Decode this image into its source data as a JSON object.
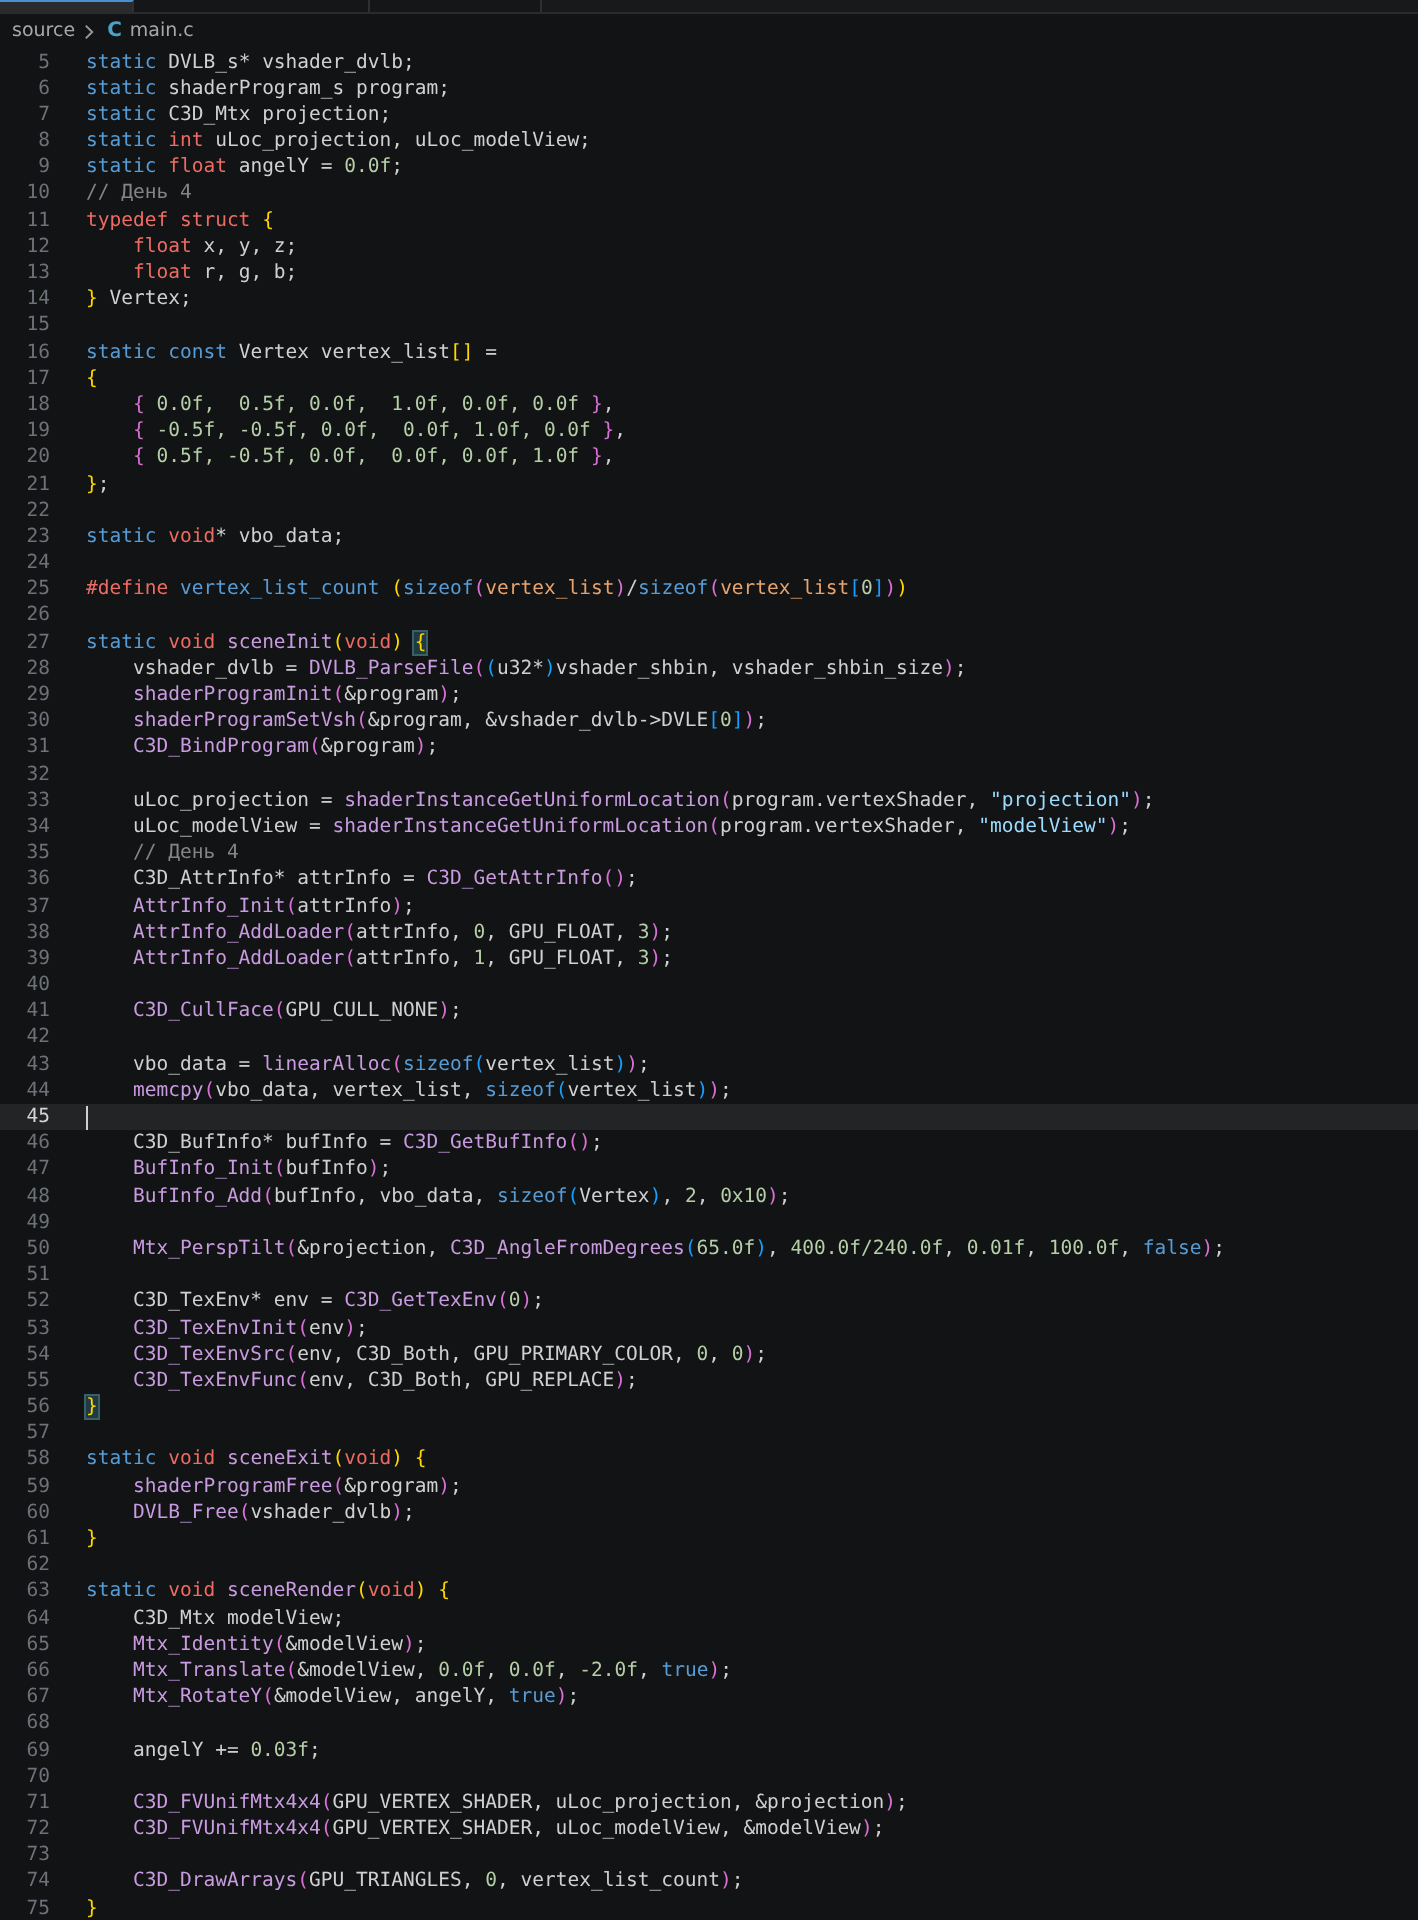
{
  "tabs": [
    {
      "selected": true
    },
    {
      "selected": false
    },
    {
      "selected": false
    }
  ],
  "breadcrumb": {
    "folder": "source",
    "file_icon": "C",
    "file": "main.c"
  },
  "lines": [
    {
      "number": "5",
      "current": false,
      "tokens": [
        {
          "kind": "kw",
          "text": "static"
        },
        {
          "kind": "txt",
          "text": " DVLB_s* vshader_dvlb;"
        }
      ]
    },
    {
      "number": "6",
      "current": false,
      "tokens": [
        {
          "kind": "kw",
          "text": "static"
        },
        {
          "kind": "txt",
          "text": " shaderProgram_s program;"
        }
      ]
    },
    {
      "number": "7",
      "current": false,
      "tokens": [
        {
          "kind": "kw",
          "text": "static"
        },
        {
          "kind": "txt",
          "text": " C3D_Mtx projection;"
        }
      ]
    },
    {
      "number": "8",
      "current": false,
      "tokens": [
        {
          "kind": "kw",
          "text": "static "
        },
        {
          "kind": "type",
          "text": "int"
        },
        {
          "kind": "txt",
          "text": " uLoc_projection, uLoc_modelView;"
        }
      ]
    },
    {
      "number": "9",
      "current": false,
      "tokens": [
        {
          "kind": "kw",
          "text": "static "
        },
        {
          "kind": "type",
          "text": "float"
        },
        {
          "kind": "txt",
          "text": " angelY = "
        },
        {
          "kind": "num",
          "text": "0.0f"
        },
        {
          "kind": "txt",
          "text": ";"
        }
      ]
    },
    {
      "number": "10",
      "current": false,
      "tokens": [
        {
          "kind": "cmt",
          "text": "// День 4"
        }
      ]
    },
    {
      "number": "11",
      "current": false,
      "tokens": [
        {
          "kind": "type",
          "text": "typedef struct "
        },
        {
          "kind": "b1",
          "text": "{"
        }
      ]
    },
    {
      "number": "12",
      "current": false,
      "tokens": [
        {
          "kind": "type",
          "text": "    float"
        },
        {
          "kind": "txt",
          "text": " x, y, z;"
        }
      ]
    },
    {
      "number": "13",
      "current": false,
      "tokens": [
        {
          "kind": "type",
          "text": "    float"
        },
        {
          "kind": "txt",
          "text": " r, g, b;"
        }
      ]
    },
    {
      "number": "14",
      "current": false,
      "tokens": [
        {
          "kind": "b1",
          "text": "}"
        },
        {
          "kind": "txt",
          "text": " Vertex;"
        }
      ]
    },
    {
      "number": "15",
      "current": false
    },
    {
      "number": "16",
      "current": false,
      "tokens": [
        {
          "kind": "kw",
          "text": "static const"
        },
        {
          "kind": "txt",
          "text": " Vertex vertex_list"
        },
        {
          "kind": "b1",
          "text": "[]"
        },
        {
          "kind": "txt",
          "text": " ="
        }
      ]
    },
    {
      "number": "17",
      "current": false,
      "tokens": [
        {
          "kind": "b1",
          "text": "{"
        }
      ]
    },
    {
      "number": "18",
      "current": false,
      "tokens": [
        {
          "kind": "b2",
          "text": "    { "
        },
        {
          "kind": "num",
          "text": "0.0f,  0.5f, 0.0f,  1.0f, 0.0f, 0.0f "
        },
        {
          "kind": "b2",
          "text": "}"
        },
        {
          "kind": "txt",
          "text": ","
        }
      ]
    },
    {
      "number": "19",
      "current": false,
      "tokens": [
        {
          "kind": "b2",
          "text": "    { "
        },
        {
          "kind": "num",
          "text": "-0.5f, -0.5f, 0.0f,  0.0f, 1.0f, 0.0f "
        },
        {
          "kind": "b2",
          "text": "}"
        },
        {
          "kind": "txt",
          "text": ","
        }
      ]
    },
    {
      "number": "20",
      "current": false,
      "tokens": [
        {
          "kind": "b2",
          "text": "    { "
        },
        {
          "kind": "num",
          "text": "0.5f, -0.5f, 0.0f,  0.0f, 0.0f, 1.0f "
        },
        {
          "kind": "b2",
          "text": "}"
        },
        {
          "kind": "txt",
          "text": ","
        }
      ]
    },
    {
      "number": "21",
      "current": false,
      "tokens": [
        {
          "kind": "b1",
          "text": "}"
        },
        {
          "kind": "txt",
          "text": ";"
        }
      ]
    },
    {
      "number": "22",
      "current": false
    },
    {
      "number": "23",
      "current": false,
      "tokens": [
        {
          "kind": "kw",
          "text": "static "
        },
        {
          "kind": "type",
          "text": "void"
        },
        {
          "kind": "txt",
          "text": "* vbo_data;"
        }
      ]
    },
    {
      "number": "24",
      "current": false
    },
    {
      "number": "25",
      "current": false,
      "tokens": [
        {
          "kind": "type",
          "text": "#define "
        },
        {
          "kind": "kw",
          "text": "vertex_list_count "
        },
        {
          "kind": "b1",
          "text": "("
        },
        {
          "kind": "kw",
          "text": "sizeof"
        },
        {
          "kind": "b2",
          "text": "("
        },
        {
          "kind": "arg",
          "text": "vertex_list"
        },
        {
          "kind": "b2",
          "text": ")"
        },
        {
          "kind": "txt",
          "text": "/"
        },
        {
          "kind": "kw",
          "text": "sizeof"
        },
        {
          "kind": "b2",
          "text": "("
        },
        {
          "kind": "arg",
          "text": "vertex_list"
        },
        {
          "kind": "b3",
          "text": "["
        },
        {
          "kind": "num",
          "text": "0"
        },
        {
          "kind": "b3",
          "text": "]"
        },
        {
          "kind": "b2",
          "text": ")"
        },
        {
          "kind": "b1",
          "text": ")"
        }
      ]
    },
    {
      "number": "26",
      "current": false
    },
    {
      "number": "27",
      "current": false,
      "tokens": [
        {
          "kind": "kw",
          "text": "static "
        },
        {
          "kind": "type",
          "text": "void "
        },
        {
          "kind": "fn",
          "text": "sceneInit"
        },
        {
          "kind": "b1",
          "text": "("
        },
        {
          "kind": "type",
          "text": "void"
        },
        {
          "kind": "b1",
          "text": ") "
        },
        {
          "kind": "match",
          "text": "{"
        }
      ]
    },
    {
      "number": "28",
      "current": false,
      "tokens": [
        {
          "kind": "txt",
          "text": "    vshader_dvlb = "
        },
        {
          "kind": "fn",
          "text": "DVLB_ParseFile"
        },
        {
          "kind": "b2",
          "text": "("
        },
        {
          "kind": "b3",
          "text": "("
        },
        {
          "kind": "txt",
          "text": "u32*"
        },
        {
          "kind": "b3",
          "text": ")"
        },
        {
          "kind": "txt",
          "text": "vshader_shbin, vshader_shbin_size"
        },
        {
          "kind": "b2",
          "text": ")"
        },
        {
          "kind": "txt",
          "text": ";"
        }
      ]
    },
    {
      "number": "29",
      "current": false,
      "tokens": [
        {
          "kind": "fn",
          "text": "    shaderProgramInit"
        },
        {
          "kind": "b2",
          "text": "("
        },
        {
          "kind": "txt",
          "text": "&program"
        },
        {
          "kind": "b2",
          "text": ")"
        },
        {
          "kind": "txt",
          "text": ";"
        }
      ]
    },
    {
      "number": "30",
      "current": false,
      "tokens": [
        {
          "kind": "fn",
          "text": "    shaderProgramSetVsh"
        },
        {
          "kind": "b2",
          "text": "("
        },
        {
          "kind": "txt",
          "text": "&program, &vshader_dvlb->DVLE"
        },
        {
          "kind": "b3",
          "text": "["
        },
        {
          "kind": "num",
          "text": "0"
        },
        {
          "kind": "b3",
          "text": "]"
        },
        {
          "kind": "b2",
          "text": ")"
        },
        {
          "kind": "txt",
          "text": ";"
        }
      ]
    },
    {
      "number": "31",
      "current": false,
      "tokens": [
        {
          "kind": "fn",
          "text": "    C3D_BindProgram"
        },
        {
          "kind": "b2",
          "text": "("
        },
        {
          "kind": "txt",
          "text": "&program"
        },
        {
          "kind": "b2",
          "text": ")"
        },
        {
          "kind": "txt",
          "text": ";"
        }
      ]
    },
    {
      "number": "32",
      "current": false
    },
    {
      "number": "33",
      "current": false,
      "tokens": [
        {
          "kind": "txt",
          "text": "    uLoc_projection = "
        },
        {
          "kind": "fn",
          "text": "shaderInstanceGetUniformLocation"
        },
        {
          "kind": "b2",
          "text": "("
        },
        {
          "kind": "txt",
          "text": "program.vertexShader, "
        },
        {
          "kind": "str",
          "text": "\"projection\""
        },
        {
          "kind": "b2",
          "text": ")"
        },
        {
          "kind": "txt",
          "text": ";"
        }
      ]
    },
    {
      "number": "34",
      "current": false,
      "tokens": [
        {
          "kind": "txt",
          "text": "    uLoc_modelView = "
        },
        {
          "kind": "fn",
          "text": "shaderInstanceGetUniformLocation"
        },
        {
          "kind": "b2",
          "text": "("
        },
        {
          "kind": "txt",
          "text": "program.vertexShader, "
        },
        {
          "kind": "str",
          "text": "\"modelView\""
        },
        {
          "kind": "b2",
          "text": ")"
        },
        {
          "kind": "txt",
          "text": ";"
        }
      ]
    },
    {
      "number": "35",
      "current": false,
      "tokens": [
        {
          "kind": "cmt",
          "text": "    // День 4"
        }
      ]
    },
    {
      "number": "36",
      "current": false,
      "tokens": [
        {
          "kind": "txt",
          "text": "    C3D_AttrInfo* attrInfo = "
        },
        {
          "kind": "fn",
          "text": "C3D_GetAttrInfo"
        },
        {
          "kind": "b2",
          "text": "()"
        },
        {
          "kind": "txt",
          "text": ";"
        }
      ]
    },
    {
      "number": "37",
      "current": false,
      "tokens": [
        {
          "kind": "fn",
          "text": "    AttrInfo_Init"
        },
        {
          "kind": "b2",
          "text": "("
        },
        {
          "kind": "txt",
          "text": "attrInfo"
        },
        {
          "kind": "b2",
          "text": ")"
        },
        {
          "kind": "txt",
          "text": ";"
        }
      ]
    },
    {
      "number": "38",
      "current": false,
      "tokens": [
        {
          "kind": "fn",
          "text": "    AttrInfo_AddLoader"
        },
        {
          "kind": "b2",
          "text": "("
        },
        {
          "kind": "txt",
          "text": "attrInfo, "
        },
        {
          "kind": "num",
          "text": "0"
        },
        {
          "kind": "txt",
          "text": ", GPU_FLOAT, "
        },
        {
          "kind": "num",
          "text": "3"
        },
        {
          "kind": "b2",
          "text": ")"
        },
        {
          "kind": "txt",
          "text": ";"
        }
      ]
    },
    {
      "number": "39",
      "current": false,
      "tokens": [
        {
          "kind": "fn",
          "text": "    AttrInfo_AddLoader"
        },
        {
          "kind": "b2",
          "text": "("
        },
        {
          "kind": "txt",
          "text": "attrInfo, "
        },
        {
          "kind": "num",
          "text": "1"
        },
        {
          "kind": "txt",
          "text": ", GPU_FLOAT, "
        },
        {
          "kind": "num",
          "text": "3"
        },
        {
          "kind": "b2",
          "text": ")"
        },
        {
          "kind": "txt",
          "text": ";"
        }
      ]
    },
    {
      "number": "40",
      "current": false
    },
    {
      "number": "41",
      "current": false,
      "tokens": [
        {
          "kind": "fn",
          "text": "    C3D_CullFace"
        },
        {
          "kind": "b2",
          "text": "("
        },
        {
          "kind": "txt",
          "text": "GPU_CULL_NONE"
        },
        {
          "kind": "b2",
          "text": ")"
        },
        {
          "kind": "txt",
          "text": ";"
        }
      ]
    },
    {
      "number": "42",
      "current": false
    },
    {
      "number": "43",
      "current": false,
      "tokens": [
        {
          "kind": "txt",
          "text": "    vbo_data = "
        },
        {
          "kind": "fn",
          "text": "linearAlloc"
        },
        {
          "kind": "b2",
          "text": "("
        },
        {
          "kind": "kw",
          "text": "sizeof"
        },
        {
          "kind": "b3",
          "text": "("
        },
        {
          "kind": "txt",
          "text": "vertex_list"
        },
        {
          "kind": "b3",
          "text": ")"
        },
        {
          "kind": "b2",
          "text": ")"
        },
        {
          "kind": "txt",
          "text": ";"
        }
      ]
    },
    {
      "number": "44",
      "current": false,
      "tokens": [
        {
          "kind": "fn",
          "text": "    memcpy"
        },
        {
          "kind": "b2",
          "text": "("
        },
        {
          "kind": "txt",
          "text": "vbo_data, vertex_list, "
        },
        {
          "kind": "kw",
          "text": "sizeof"
        },
        {
          "kind": "b3",
          "text": "("
        },
        {
          "kind": "txt",
          "text": "vertex_list"
        },
        {
          "kind": "b3",
          "text": ")"
        },
        {
          "kind": "b2",
          "text": ")"
        },
        {
          "kind": "txt",
          "text": ";"
        }
      ]
    },
    {
      "number": "45",
      "current": true
    },
    {
      "number": "46",
      "current": false,
      "tokens": [
        {
          "kind": "txt",
          "text": "    C3D_BufInfo* bufInfo = "
        },
        {
          "kind": "fn",
          "text": "C3D_GetBufInfo"
        },
        {
          "kind": "b2",
          "text": "()"
        },
        {
          "kind": "txt",
          "text": ";"
        }
      ]
    },
    {
      "number": "47",
      "current": false,
      "tokens": [
        {
          "kind": "fn",
          "text": "    BufInfo_Init"
        },
        {
          "kind": "b2",
          "text": "("
        },
        {
          "kind": "txt",
          "text": "bufInfo"
        },
        {
          "kind": "b2",
          "text": ")"
        },
        {
          "kind": "txt",
          "text": ";"
        }
      ]
    },
    {
      "number": "48",
      "current": false,
      "tokens": [
        {
          "kind": "fn",
          "text": "    BufInfo_Add"
        },
        {
          "kind": "b2",
          "text": "("
        },
        {
          "kind": "txt",
          "text": "bufInfo, vbo_data, "
        },
        {
          "kind": "kw",
          "text": "sizeof"
        },
        {
          "kind": "b3",
          "text": "("
        },
        {
          "kind": "txt",
          "text": "Vertex"
        },
        {
          "kind": "b3",
          "text": ")"
        },
        {
          "kind": "txt",
          "text": ", "
        },
        {
          "kind": "num",
          "text": "2"
        },
        {
          "kind": "txt",
          "text": ", "
        },
        {
          "kind": "num",
          "text": "0x10"
        },
        {
          "kind": "b2",
          "text": ")"
        },
        {
          "kind": "txt",
          "text": ";"
        }
      ]
    },
    {
      "number": "49",
      "current": false
    },
    {
      "number": "50",
      "current": false,
      "tokens": [
        {
          "kind": "fn",
          "text": "    Mtx_PerspTilt"
        },
        {
          "kind": "b2",
          "text": "("
        },
        {
          "kind": "txt",
          "text": "&projection, "
        },
        {
          "kind": "fn",
          "text": "C3D_AngleFromDegrees"
        },
        {
          "kind": "b3",
          "text": "("
        },
        {
          "kind": "num",
          "text": "65.0f"
        },
        {
          "kind": "b3",
          "text": ")"
        },
        {
          "kind": "txt",
          "text": ", "
        },
        {
          "kind": "num",
          "text": "400.0f/240.0f"
        },
        {
          "kind": "txt",
          "text": ", "
        },
        {
          "kind": "num",
          "text": "0.01f"
        },
        {
          "kind": "txt",
          "text": ", "
        },
        {
          "kind": "num",
          "text": "100.0f"
        },
        {
          "kind": "txt",
          "text": ", "
        },
        {
          "kind": "kw",
          "text": "false"
        },
        {
          "kind": "b2",
          "text": ")"
        },
        {
          "kind": "txt",
          "text": ";"
        }
      ]
    },
    {
      "number": "51",
      "current": false
    },
    {
      "number": "52",
      "current": false,
      "tokens": [
        {
          "kind": "txt",
          "text": "    C3D_TexEnv* env = "
        },
        {
          "kind": "fn",
          "text": "C3D_GetTexEnv"
        },
        {
          "kind": "b2",
          "text": "("
        },
        {
          "kind": "num",
          "text": "0"
        },
        {
          "kind": "b2",
          "text": ")"
        },
        {
          "kind": "txt",
          "text": ";"
        }
      ]
    },
    {
      "number": "53",
      "current": false,
      "tokens": [
        {
          "kind": "fn",
          "text": "    C3D_TexEnvInit"
        },
        {
          "kind": "b2",
          "text": "("
        },
        {
          "kind": "txt",
          "text": "env"
        },
        {
          "kind": "b2",
          "text": ")"
        },
        {
          "kind": "txt",
          "text": ";"
        }
      ]
    },
    {
      "number": "54",
      "current": false,
      "tokens": [
        {
          "kind": "fn",
          "text": "    C3D_TexEnvSrc"
        },
        {
          "kind": "b2",
          "text": "("
        },
        {
          "kind": "txt",
          "text": "env, C3D_Both, GPU_PRIMARY_COLOR, "
        },
        {
          "kind": "num",
          "text": "0"
        },
        {
          "kind": "txt",
          "text": ", "
        },
        {
          "kind": "num",
          "text": "0"
        },
        {
          "kind": "b2",
          "text": ")"
        },
        {
          "kind": "txt",
          "text": ";"
        }
      ]
    },
    {
      "number": "55",
      "current": false,
      "tokens": [
        {
          "kind": "fn",
          "text": "    C3D_TexEnvFunc"
        },
        {
          "kind": "b2",
          "text": "("
        },
        {
          "kind": "txt",
          "text": "env, C3D_Both, GPU_REPLACE"
        },
        {
          "kind": "b2",
          "text": ")"
        },
        {
          "kind": "txt",
          "text": ";"
        }
      ]
    },
    {
      "number": "56",
      "current": false,
      "tokens": [
        {
          "kind": "match",
          "text": "}"
        }
      ]
    },
    {
      "number": "57",
      "current": false
    },
    {
      "number": "58",
      "current": false,
      "tokens": [
        {
          "kind": "kw",
          "text": "static "
        },
        {
          "kind": "type",
          "text": "void "
        },
        {
          "kind": "fn",
          "text": "sceneExit"
        },
        {
          "kind": "b1",
          "text": "("
        },
        {
          "kind": "type",
          "text": "void"
        },
        {
          "kind": "b1",
          "text": ") {"
        }
      ]
    },
    {
      "number": "59",
      "current": false,
      "tokens": [
        {
          "kind": "fn",
          "text": "    shaderProgramFree"
        },
        {
          "kind": "b2",
          "text": "("
        },
        {
          "kind": "txt",
          "text": "&program"
        },
        {
          "kind": "b2",
          "text": ")"
        },
        {
          "kind": "txt",
          "text": ";"
        }
      ]
    },
    {
      "number": "60",
      "current": false,
      "tokens": [
        {
          "kind": "fn",
          "text": "    DVLB_Free"
        },
        {
          "kind": "b2",
          "text": "("
        },
        {
          "kind": "txt",
          "text": "vshader_dvlb"
        },
        {
          "kind": "b2",
          "text": ")"
        },
        {
          "kind": "txt",
          "text": ";"
        }
      ]
    },
    {
      "number": "61",
      "current": false,
      "tokens": [
        {
          "kind": "b1",
          "text": "}"
        }
      ]
    },
    {
      "number": "62",
      "current": false
    },
    {
      "number": "63",
      "current": false,
      "tokens": [
        {
          "kind": "kw",
          "text": "static "
        },
        {
          "kind": "type",
          "text": "void "
        },
        {
          "kind": "fn",
          "text": "sceneRender"
        },
        {
          "kind": "b1",
          "text": "("
        },
        {
          "kind": "type",
          "text": "void"
        },
        {
          "kind": "b1",
          "text": ") {"
        }
      ]
    },
    {
      "number": "64",
      "current": false,
      "tokens": [
        {
          "kind": "txt",
          "text": "    C3D_Mtx modelView;"
        }
      ]
    },
    {
      "number": "65",
      "current": false,
      "tokens": [
        {
          "kind": "fn",
          "text": "    Mtx_Identity"
        },
        {
          "kind": "b2",
          "text": "("
        },
        {
          "kind": "txt",
          "text": "&modelView"
        },
        {
          "kind": "b2",
          "text": ")"
        },
        {
          "kind": "txt",
          "text": ";"
        }
      ]
    },
    {
      "number": "66",
      "current": false,
      "tokens": [
        {
          "kind": "fn",
          "text": "    Mtx_Translate"
        },
        {
          "kind": "b2",
          "text": "("
        },
        {
          "kind": "txt",
          "text": "&modelView, "
        },
        {
          "kind": "num",
          "text": "0.0f"
        },
        {
          "kind": "txt",
          "text": ", "
        },
        {
          "kind": "num",
          "text": "0.0f"
        },
        {
          "kind": "txt",
          "text": ", "
        },
        {
          "kind": "num",
          "text": "-2.0f"
        },
        {
          "kind": "txt",
          "text": ", "
        },
        {
          "kind": "kw",
          "text": "true"
        },
        {
          "kind": "b2",
          "text": ")"
        },
        {
          "kind": "txt",
          "text": ";"
        }
      ]
    },
    {
      "number": "67",
      "current": false,
      "tokens": [
        {
          "kind": "fn",
          "text": "    Mtx_RotateY"
        },
        {
          "kind": "b2",
          "text": "("
        },
        {
          "kind": "txt",
          "text": "&modelView, angelY, "
        },
        {
          "kind": "kw",
          "text": "true"
        },
        {
          "kind": "b2",
          "text": ")"
        },
        {
          "kind": "txt",
          "text": ";"
        }
      ]
    },
    {
      "number": "68",
      "current": false
    },
    {
      "number": "69",
      "current": false,
      "tokens": [
        {
          "kind": "txt",
          "text": "    angelY += "
        },
        {
          "kind": "num",
          "text": "0.03f"
        },
        {
          "kind": "txt",
          "text": ";"
        }
      ]
    },
    {
      "number": "70",
      "current": false
    },
    {
      "number": "71",
      "current": false,
      "tokens": [
        {
          "kind": "fn",
          "text": "    C3D_FVUnifMtx4x4"
        },
        {
          "kind": "b2",
          "text": "("
        },
        {
          "kind": "txt",
          "text": "GPU_VERTEX_SHADER, uLoc_projection, &projection"
        },
        {
          "kind": "b2",
          "text": ")"
        },
        {
          "kind": "txt",
          "text": ";"
        }
      ]
    },
    {
      "number": "72",
      "current": false,
      "tokens": [
        {
          "kind": "fn",
          "text": "    C3D_FVUnifMtx4x4"
        },
        {
          "kind": "b2",
          "text": "("
        },
        {
          "kind": "txt",
          "text": "GPU_VERTEX_SHADER, uLoc_modelView, &modelView"
        },
        {
          "kind": "b2",
          "text": ")"
        },
        {
          "kind": "txt",
          "text": ";"
        }
      ]
    },
    {
      "number": "73",
      "current": false
    },
    {
      "number": "74",
      "current": false,
      "tokens": [
        {
          "kind": "fn",
          "text": "    C3D_DrawArrays"
        },
        {
          "kind": "b2",
          "text": "("
        },
        {
          "kind": "txt",
          "text": "GPU_TRIANGLES, "
        },
        {
          "kind": "num",
          "text": "0"
        },
        {
          "kind": "txt",
          "text": ", vertex_list_count"
        },
        {
          "kind": "b2",
          "text": ")"
        },
        {
          "kind": "txt",
          "text": ";"
        }
      ]
    },
    {
      "number": "75",
      "current": false,
      "tokens": [
        {
          "kind": "b1",
          "text": "}"
        }
      ]
    }
  ]
}
